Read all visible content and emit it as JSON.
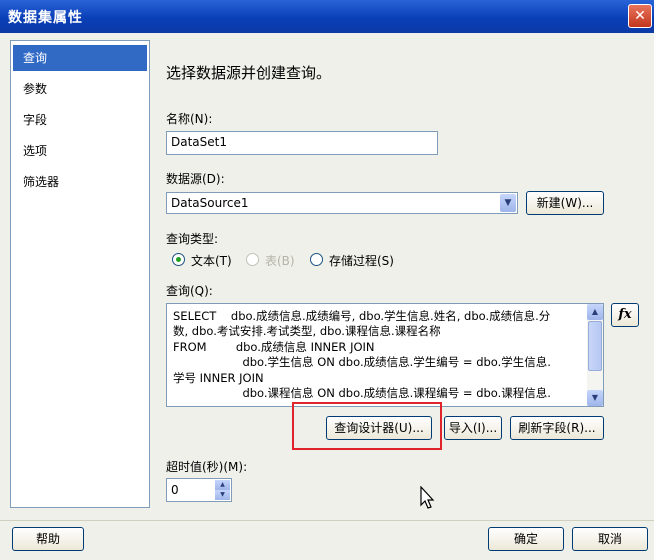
{
  "window": {
    "title": "数据集属性",
    "close_glyph": "✕"
  },
  "nav": {
    "items": [
      {
        "label": "查询",
        "selected": true
      },
      {
        "label": "参数"
      },
      {
        "label": "字段"
      },
      {
        "label": "选项"
      },
      {
        "label": "筛选器"
      }
    ]
  },
  "content": {
    "heading": "选择数据源并创建查询。",
    "name_label": "名称(N):",
    "name_value": "DataSet1",
    "datasource_label": "数据源(D):",
    "datasource_value": "DataSource1",
    "new_button": "新建(W)...",
    "query_type_label": "查询类型:",
    "query_type_options": [
      {
        "label": "文本(T)",
        "checked": true,
        "enabled": true
      },
      {
        "label": "表(B)",
        "checked": false,
        "enabled": false
      },
      {
        "label": "存储过程(S)",
        "checked": false,
        "enabled": true
      }
    ],
    "query_label": "查询(Q):",
    "query_lines": [
      "SELECT    dbo.成绩信息.成绩编号, dbo.学生信息.姓名, dbo.成绩信息.分",
      "数, dbo.考试安排.考试类型, dbo.课程信息.课程名称",
      "FROM        dbo.成绩信息 INNER JOIN",
      "                   dbo.学生信息 ON dbo.成绩信息.学生编号 = dbo.学生信息.",
      "学号 INNER JOIN",
      "                   dbo.课程信息 ON dbo.成绩信息.课程编号 = dbo.课程信息."
    ],
    "fx_button": "fx",
    "query_designer_button": "查询设计器(U)...",
    "import_button": "导入(I)...",
    "refresh_fields_button": "刷新字段(R)...",
    "timeout_label": "超时值(秒)(M):",
    "timeout_value": "0"
  },
  "footer": {
    "help_button": "帮助",
    "ok_button": "确定",
    "cancel_button": "取消"
  },
  "colors": {
    "highlight": "#e0242b",
    "selection": "#316ac5",
    "title_bar": "#0a3fb8"
  }
}
